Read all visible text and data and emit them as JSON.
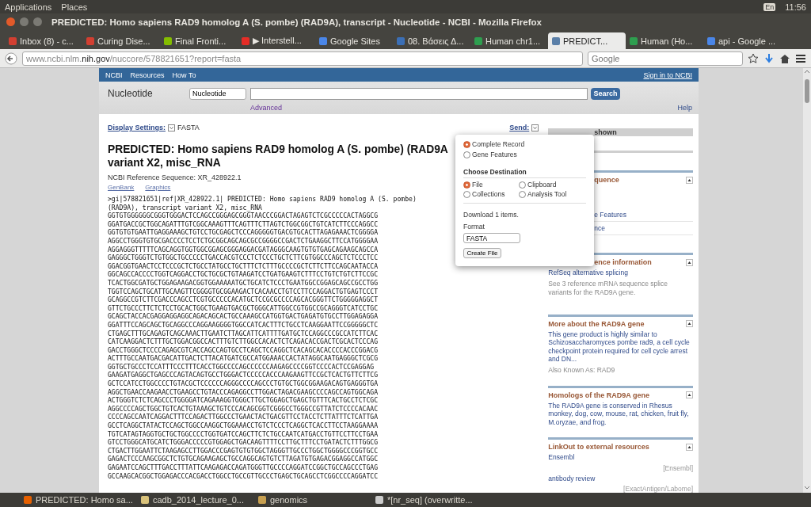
{
  "top_panel": {
    "menus": [
      "Applications",
      "Places"
    ],
    "keyboard": "En",
    "time": "11:56"
  },
  "window": {
    "title": "PREDICTED: Homo sapiens RAD9 homolog A (S. pombe) (RAD9A), transcript - Nucleotide - NCBI - Mozilla Firefox"
  },
  "tabs": [
    {
      "label": "Inbox (8) - c...",
      "selected": false,
      "color": "#d23f31"
    },
    {
      "label": "Curing Dise...",
      "selected": false,
      "color": "#d23f31"
    },
    {
      "label": "Final Fronti...",
      "selected": false,
      "color": "#84bd00"
    },
    {
      "label": "▶ Interstell...",
      "selected": false,
      "color": "#e52d27"
    },
    {
      "label": "Google Sites",
      "selected": false,
      "color": "#4a86e8"
    },
    {
      "label": "08. Βάσεις Δ...",
      "selected": false,
      "color": "#3b6fb6"
    },
    {
      "label": "Human chr1...",
      "selected": false,
      "color": "#2e9e4f"
    },
    {
      "label": "PREDICT...",
      "selected": true,
      "color": "#5a7fa8"
    },
    {
      "label": "Human (Ho...",
      "selected": false,
      "color": "#2e9e4f"
    },
    {
      "label": "api - Google ...",
      "selected": false,
      "color": "#4a86e8"
    }
  ],
  "address_bar": {
    "url": "www.ncbi.nlm.**nih.gov**/nuccore/578821651?report=fasta",
    "search_placeholder": "Google"
  },
  "ncbi_header": {
    "logo": "NCBI",
    "menus": [
      "Resources",
      "How To"
    ],
    "sign_in": "Sign in to NCBI"
  },
  "search": {
    "database_title": "Nucleotide",
    "database_select": "Nucleotide",
    "button": "Search",
    "advanced": "Advanced",
    "help": "Help"
  },
  "display_settings": {
    "label": "Display Settings:",
    "value": "FASTA",
    "send": "Send:"
  },
  "record": {
    "title_lines": [
      "PREDICTED: Homo sapiens RAD9 homolog A (S. pombe) (RAD9A",
      "variant X2, misc_RNA"
    ],
    "reference": "NCBI Reference Sequence: XR_428922.1",
    "links": [
      "GenBank",
      "Graphics"
    ]
  },
  "fasta_header": [
    ">gi|578821651|ref|XR_428922.1| PREDICTED: Homo sapiens RAD9 homolog A (S. pombe)",
    "(RAD9A), transcript variant X2, misc_RNA"
  ],
  "sequence": [
    "GGTGTGGGGGGCGGGTGGGACTCCAGCCGGGAGCGGGTAACCCGGACTAGAGTCTCGCCCCCACTAGGCG",
    "GGATGACCGCTGGCAGATTTGTCGGCAAAGTTTCAGTTTCTTAGTCTGGCGGCTGTCATCTTCCCAGGCC",
    "GGTGTGTGAATTGAGGAAAGCTGTCCTGCGAGCTCCCAGGGGGTGACGTGCACTTAGAGAAACTCGGGGA",
    "AGGCCTGGGTGTGCGACCCCTCCTCTGCGGCAGCAGCGCCGGGGCCGACTCTGAAGGCTTCCATGGGGAA",
    "AGGAGGGTTTTTCAGCAGGTGGTGGCGGAGCGGGAGGACGATAGGGCAAGTGTGTGAGCAGAAGCAGCCA",
    "GAGGGCTGGGTCTGTGGCTGCCCCCTGACCACGTCCCTCTCCCTGCTCTTCGTGGCCCAGCTCTCCCTCC",
    "GGACGGTGAACTCCTCCCGCTCTGCCTATGCCTGCTTTCTCTTTGCCCCGCTCTTCTTCCAGCAATACCA",
    "GGCAGCCACCCCTGGTCAGGACCTGCTGCGCTGTAAGATCCTGATGAAGTCTTTCCTGTCTGTCTTCCGC",
    "TCACTGGCGATGCTGGAGAAGACGGTGGAAAAATGCTGCATCTCCCTGAATGGCCGGAGCAGCCGCCTGG",
    "TGGTCCAGCTGCATTGCAAGTTCGGGGTGCGGAAGACTCACAACCTGTCCTTCCAGGACTGTGAGTCCCT",
    "GCAGGCCGTCTTCGACCCAGCCTCGTGCCCCCACATGCTCCGCGCCCCAGCACGGGTTCTGGGGGAGGCT",
    "GTTCTGCCCTTCTCTCCTGCACTGGCTGAAGTGACGCTGGGCATTGGCCGTGGCCGCAGGGTCATCCTGC",
    "GCAGCTACCACGAGGAGGAGGCAGACAGCACTGCCAAAGCCATGGTGACTGAGATGTGCCTTGGAGAGGA",
    "GGATTTCCAGCAGCTGCAGGCCCAGGAAGGGGTGGCCATCACTTTCTGCCTCAAGGAATTCCGGGGGCTC",
    "CTGAGCTTTGCAGAGTCAGCAAACTTGAATCTTAGCATTCATTTTGATGCTCCAGGCCCGCCATCTTCAC",
    "CATCAAGGACTCTTTGCTGGACGGCCACTTTGTCTTGGCCACACTCTCAGACACCGACTCGCACTCCCAG",
    "GACCTGGGCTCCCCAGAGCGTCACCAGCCAGTGCCTCAGCTCCAGGCTCACAGCACACCCCACCCGGACG",
    "ACTTTGCCAATGACGACATTGACTCTTACATGATCGCCATGGAAACCACTATAGGCAATGAGGGCTCGCG",
    "GGTGCTGCCCTCCATTTCCCTTTCACCTGGCCCCAGCCCCCCAAGAGCCCCGGTCCCCACTCCGAGGAG",
    "GAAGATGAGGCTGAGCCCAGTACAGTGCCTGGGACTCCCCCACCCAAGAAGTTCCGCTCACTGTTCTTCG",
    "GCTCCATCCTGGCCCCTGTACGCTCCCCCCAGGGCCCCAGCCCTGTGCTGGCGGAAGACAGTGAGGGTGA",
    "AGGCTGAACCAAGAACCTGAAGCCTGTACCCAGAGGCCTTGGACTAGACGAAGCCCCAGCCAGTGGCAGA",
    "ACTGGGTCTCTCAGCCCTGGGGATCAGAAAGGTGGGCTTGCTGGAGCTGAGCTGTTTCACTGCCTCTCGC",
    "AGGCCCCAGCTGGCTGTCACTGTAAAGCTGTCCCACAGCGGTCGGGCCTGGGCCGTTATCTCCCCACAAC",
    "CCCCAGCCAATCAGGACTTTCCAGACTTGGCCCTGAACTACTGACGTTCCTACCTCTTATTTCTCATTGA",
    "GCCTCAGGCTATACTCCAGCTGGCCAAGGCTGGAAACCTGTCTCCCTCAGGCTCACCTTCCTAAGGAAAA",
    "TGTCATAGTAGGTGCTGCTGGCCCCTGGTGATCCAGCTTCTCTGCCAATCATGACCTGTTCCTTCCTGAA",
    "GTCCTGGGCATGCATCTGGGACCCCCGTGGAGCTGACAAGTTTTCCTTGCTTTCCTGATACTCTTTGGCG",
    "CTGACTTGGAATTCTAAGAGCCTTGGACCCGAGTGTGTGGCTAGGGTTGCCCTGGCTGGGGCCCGGTGCC",
    "GAGACTCCCAAGCGGCTCTGTGCAGAAGAGCTGCCAGGCAGTGTCTTAGATGTGAGACGGAGGCCATGGC",
    "GAGAATCCAGCTTTGACCTTTATTCAAGAGACCAGATGGGTTGCCCCAGGATCCGGCTGCCAGCCCTGAG",
    "GCCAAGCACGGCTGGAGACCCACGACCTGGCCTGCCGTTGCCCTGAGCTGCAGCCTCGGCCCCAGGATCC"
  ],
  "send_popup": {
    "record_options": [
      {
        "label": "Complete Record",
        "selected": true
      },
      {
        "label": "Gene Features",
        "selected": false
      }
    ],
    "destination_heading": "Choose Destination",
    "destinations": [
      {
        "label": "File",
        "selected": true
      },
      {
        "label": "Clipboard",
        "selected": false
      },
      {
        "label": "Collections",
        "selected": false
      },
      {
        "label": "Analysis Tool",
        "selected": false
      }
    ],
    "download_note": "Download 1 items.",
    "format_label": "Format",
    "format_value": "FASTA",
    "button": "Create File"
  },
  "sidebar": {
    "region_bar": "shown",
    "analyze_heading": "quence",
    "analyze_links": [
      "e Features",
      "nce"
    ],
    "related_heading": "ence information",
    "related_link": "RefSeq alternative splicing",
    "related_text": "See 3 reference mRNA sequence splice variants for the RAD9A gene.",
    "sections": [
      {
        "heading": "More about the RAD9A gene",
        "kind": "gene",
        "text": "This gene product is highly similar to Schizosaccharomyces pombe rad9, a cell cycle checkpoint protein required for cell cycle arrest and DN...",
        "note": "Also Known As: RAD9"
      },
      {
        "heading": "Homologs of the RAD9A gene",
        "kind": "homologs",
        "text": "The RAD9A gene is conserved in Rhesus monkey, dog, cow, mouse, rat, chicken, fruit fly, M.oryzae, and frog."
      },
      {
        "heading": "LinkOut to external resources",
        "kind": "linkout",
        "links": [
          {
            "label": "Ensembl",
            "source": "[Ensembl]"
          },
          {
            "label": "antibody review",
            "source": "[ExactAntigen/Labome]"
          }
        ]
      }
    ]
  },
  "taskbar": [
    {
      "label": "PREDICTED: Homo sa...",
      "color": "#e66000"
    },
    {
      "label": "cadb_2014_lecture_0...",
      "color": "#d9c27a"
    },
    {
      "label": "genomics",
      "color": "#c8a050"
    },
    {
      "label": "*[nr_seq] (overwritte...",
      "color": "#cccccc"
    }
  ]
}
